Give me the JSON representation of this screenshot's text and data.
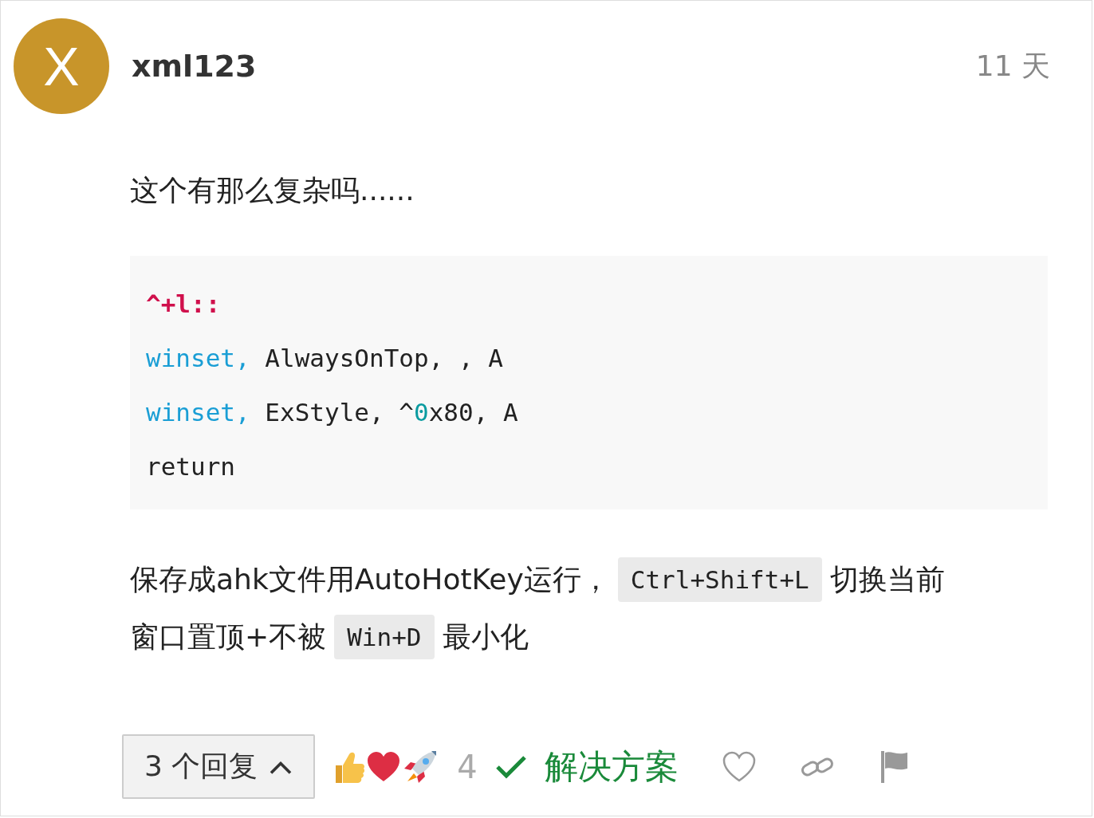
{
  "post": {
    "author": {
      "avatar_letter": "X",
      "username": "xml123"
    },
    "time": "11 天",
    "intro": "这个有那么复杂吗......",
    "code": [
      [
        {
          "kind": "label",
          "text": "^+l::"
        }
      ],
      [
        {
          "kind": "keyword",
          "text": "winset,"
        },
        {
          "kind": "plain",
          "text": " AlwaysOnTop, , A"
        }
      ],
      [
        {
          "kind": "keyword",
          "text": "winset,"
        },
        {
          "kind": "plain",
          "text": " ExStyle, ^"
        },
        {
          "kind": "number",
          "text": "0"
        },
        {
          "kind": "plain",
          "text": "x80, A"
        }
      ],
      [
        {
          "kind": "plain",
          "text": "return"
        }
      ]
    ],
    "paragraph": [
      [
        {
          "kind": "text",
          "text": "保存成ahk文件用AutoHotKey运行，"
        },
        {
          "kind": "code",
          "text": "Ctrl+Shift+L"
        },
        {
          "kind": "text",
          "text": "切换当前"
        }
      ],
      [
        {
          "kind": "text",
          "text": "窗口置顶+不被"
        },
        {
          "kind": "code",
          "text": "Win+D"
        },
        {
          "kind": "text",
          "text": "最小化"
        }
      ]
    ],
    "replies_button": {
      "label": "3 个回复",
      "expanded": true
    },
    "reaction_count": "4",
    "solution_label": "解决方案"
  }
}
